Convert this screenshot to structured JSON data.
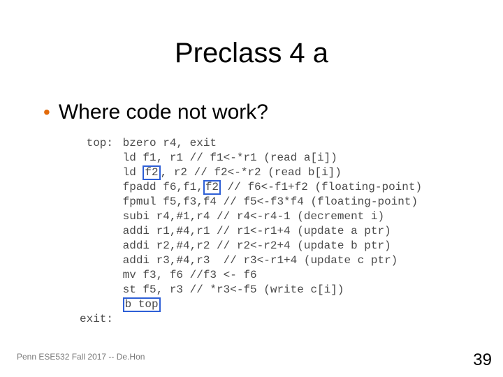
{
  "title": "Preclass 4 a",
  "bullet": "Where code not work?",
  "code": {
    "top_label": "top:",
    "top_instr": "bzero r4, exit",
    "l1_a": "ld f1, r1 // f1<-*r1 (read a[i])",
    "l2_pre": "ld ",
    "l2_hl": "f2",
    "l2_post": ", r2 // f2<-*r2 (read b[i])",
    "l3_pre": "fpadd f6,f1,",
    "l3_hl": "f2",
    "l3_post": " // f6<-f1+f2 (floating-point)",
    "l4": "fpmul f5,f3,f4 // f5<-f3*f4 (floating-point)",
    "l5": "subi r4,#1,r4 // r4<-r4-1 (decrement i)",
    "l6": "addi r1,#4,r1 // r1<-r1+4 (update a ptr)",
    "l7": "addi r2,#4,r2 // r2<-r2+4 (update b ptr)",
    "l8": "addi r3,#4,r3  // r3<-r1+4 (update c ptr)",
    "l9": "mv f3, f6 //f3 <- f6",
    "l10": "st f5, r3 // *r3<-f5 (write c[i])",
    "l11_hl": "b top",
    "exit_label": "exit:"
  },
  "footer": "Penn ESE532 Fall 2017 -- De.Hon",
  "page": "39"
}
